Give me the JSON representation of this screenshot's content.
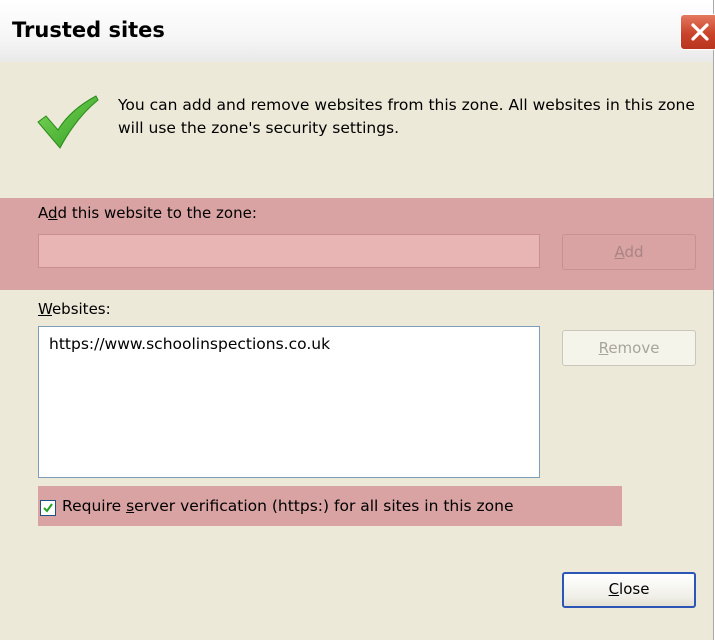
{
  "dialog": {
    "title": "Trusted sites",
    "intro_text": "You can add and remove websites from this zone. All websites in this zone will use the zone's security settings.",
    "add_label": "Add this website to the zone:",
    "add_input_value": "",
    "add_button_label": "Add",
    "websites_label": "Websites:",
    "websites": [
      "https://www.schoolinspections.co.uk"
    ],
    "remove_button_label": "Remove",
    "require_verification_label": "Require server verification (https:) for all sites in this zone",
    "require_verification_checked": true,
    "close_button_label": "Close"
  },
  "icons": {
    "title_close": "close-icon",
    "info": "green-checkmark-icon",
    "checkbox_mark": "checkmark-icon"
  },
  "colors": {
    "dialog_bg": "#ece9d8",
    "highlight": "#d8a3a2",
    "close_red": "#c9442a",
    "check_green": "#3fae2a",
    "focus_blue": "#2b56b8"
  }
}
